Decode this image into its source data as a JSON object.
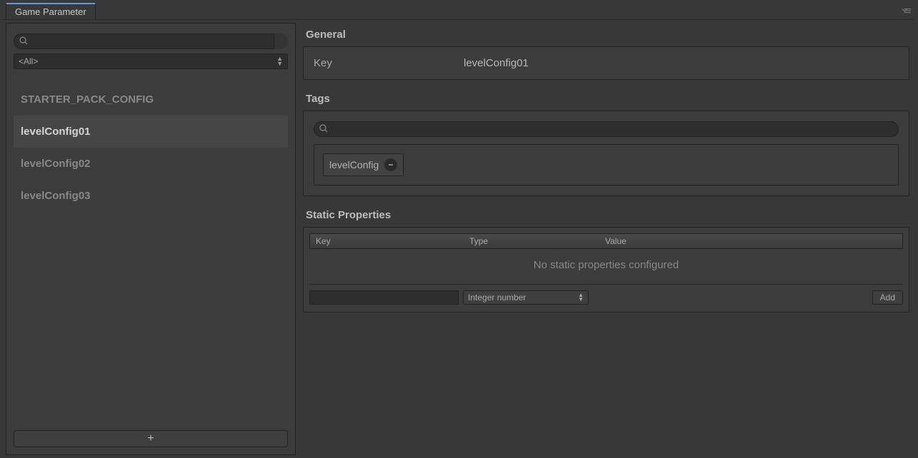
{
  "tab_title": "Game Parameter",
  "sidebar": {
    "search_placeholder": "",
    "filter_selected": "<All>",
    "items": [
      {
        "label": "STARTER_PACK_CONFIG",
        "selected": false
      },
      {
        "label": "levelConfig01",
        "selected": true
      },
      {
        "label": "levelConfig02",
        "selected": false
      },
      {
        "label": "levelConfig03",
        "selected": false
      }
    ],
    "add_label": "+"
  },
  "general": {
    "title": "General",
    "key_label": "Key",
    "key_value": "levelConfig01"
  },
  "tags": {
    "title": "Tags",
    "search_placeholder": "",
    "chips": [
      {
        "label": "levelConfig"
      }
    ]
  },
  "static_props": {
    "title": "Static Properties",
    "columns": {
      "key": "Key",
      "type": "Type",
      "value": "Value"
    },
    "rows": [],
    "empty_message": "No static properties configured",
    "new_key_value": "",
    "type_selected": "Integer number",
    "add_label": "Add"
  }
}
